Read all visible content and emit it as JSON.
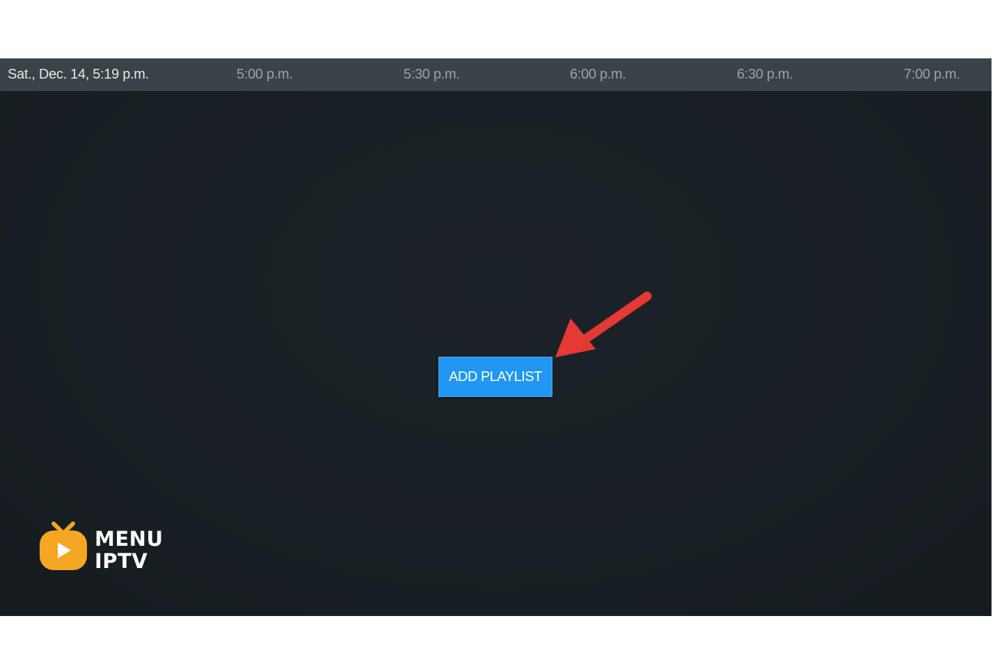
{
  "timebar": {
    "current": "Sat., Dec. 14, 5:19 p.m.",
    "slots": [
      "5:00 p.m.",
      "5:30 p.m.",
      "6:00 p.m.",
      "6:30 p.m.",
      "7:00 p.m."
    ]
  },
  "main": {
    "add_playlist_label": "ADD PLAYLIST"
  },
  "logo": {
    "line1": "MENU",
    "line2": "IPTV",
    "icon": "tv-play-icon"
  },
  "colors": {
    "background": "#192025",
    "timebar": "#3a4348",
    "button": "#2196f3",
    "arrow": "#e53935",
    "logo_accent": "#f5a623"
  }
}
